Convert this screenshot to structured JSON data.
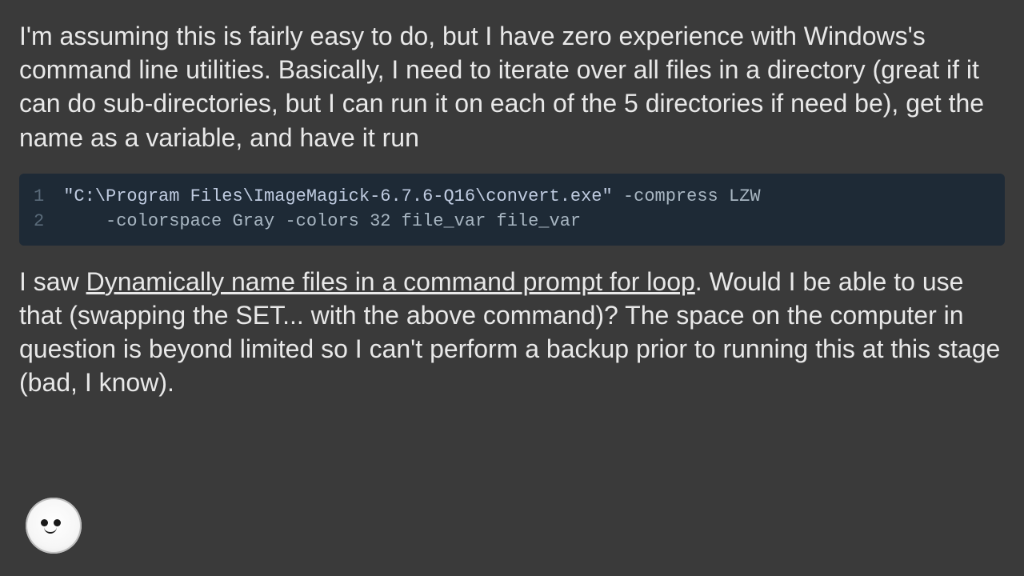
{
  "para1": "I'm assuming this is fairly easy to do, but I have zero experience with Windows's command line utilities. Basically, I need to iterate over all files in a directory (great if it can do sub-directories, but I can run it on each of the 5 directories if need be), get the name as a variable, and have it run",
  "code": {
    "gutter": [
      "1",
      "2"
    ],
    "line1_str": "\"C:\\Program Files\\ImageMagick-6.7.6-Q16\\convert.exe\"",
    "line1_rest": " -compress LZW ",
    "line2": "    -colorspace Gray -colors 32 file_var file_var"
  },
  "para2_pre": "I saw ",
  "para2_link": "Dynamically name files in a command prompt for loop",
  "para2_post": ". Would I be able to use that (swapping the SET... with the above command)? The space on the computer in question is beyond limited so I can't perform a backup prior to running this at this stage (bad, I know)."
}
